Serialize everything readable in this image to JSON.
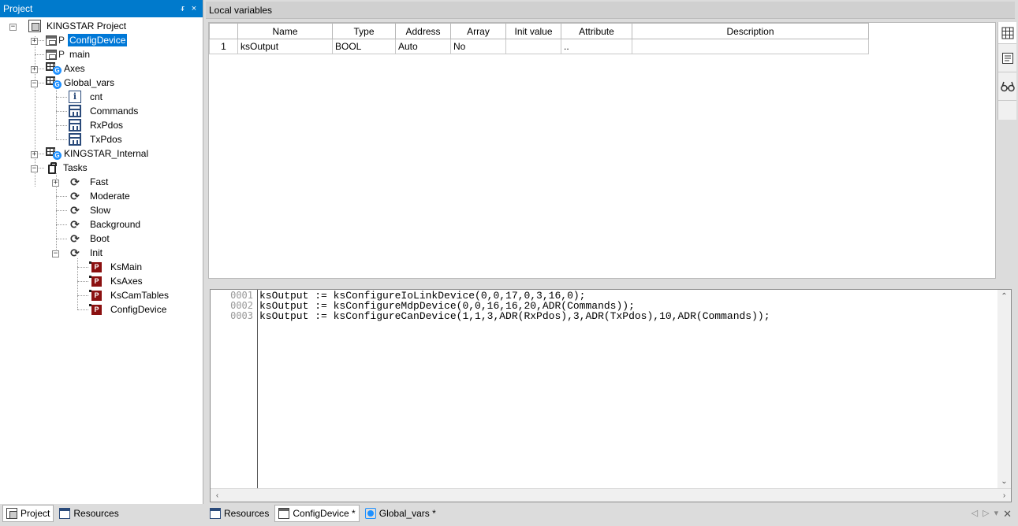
{
  "project_panel": {
    "title": "Project",
    "pin_label": "ᵲ",
    "close_label": "×",
    "tree": [
      {
        "label": "KINGSTAR Project",
        "icon": "project-icon"
      },
      {
        "label": "ConfigDevice",
        "icon": "pou-icon",
        "selected": true
      },
      {
        "label": "main",
        "icon": "pou-icon"
      },
      {
        "label": "Axes",
        "icon": "global-vars-icon"
      },
      {
        "label": "Global_vars",
        "icon": "global-vars-icon"
      },
      {
        "label": "cnt",
        "icon": "info-icon"
      },
      {
        "label": "Commands",
        "icon": "struct-icon"
      },
      {
        "label": "RxPdos",
        "icon": "struct-icon"
      },
      {
        "label": "TxPdos",
        "icon": "struct-icon"
      },
      {
        "label": "KINGSTAR_Internal",
        "icon": "global-vars-icon"
      },
      {
        "label": "Tasks",
        "icon": "tasks-icon"
      },
      {
        "label": "Fast",
        "icon": "cycle-icon"
      },
      {
        "label": "Moderate",
        "icon": "cycle-icon"
      },
      {
        "label": "Slow",
        "icon": "cycle-icon"
      },
      {
        "label": "Background",
        "icon": "cycle-icon"
      },
      {
        "label": "Boot",
        "icon": "cycle-icon"
      },
      {
        "label": "Init",
        "icon": "cycle-icon"
      },
      {
        "label": "KsMain",
        "icon": "program-icon"
      },
      {
        "label": "KsAxes",
        "icon": "program-icon"
      },
      {
        "label": "KsCamTables",
        "icon": "program-icon"
      },
      {
        "label": "ConfigDevice",
        "icon": "program-icon"
      }
    ],
    "p_letter": "P",
    "g_letter": "G",
    "i_letter": "i",
    "prg_letter": "P",
    "bottom_tabs": [
      {
        "label": "Project",
        "active": true
      },
      {
        "label": "Resources",
        "active": false
      }
    ]
  },
  "local_variables": {
    "title": "Local variables",
    "columns": [
      "Name",
      "Type",
      "Address",
      "Array",
      "Init value",
      "Attribute",
      "Description"
    ],
    "rows": [
      {
        "num": "1",
        "name": "ksOutput",
        "type": "BOOL",
        "address": "Auto",
        "array": "No",
        "init_value": "",
        "attribute": "..",
        "description": ""
      }
    ]
  },
  "editor": {
    "lines": [
      {
        "num": "0001",
        "code": "ksOutput := ksConfigureIoLinkDevice(0,0,17,0,3,16,0);"
      },
      {
        "num": "0002",
        "code": "ksOutput := ksConfigureMdpDevice(0,0,16,16,20,ADR(Commands));"
      },
      {
        "num": "0003",
        "code": "ksOutput := ksConfigureCanDevice(1,1,3,ADR(RxPdos),3,ADR(TxPdos),10,ADR(Commands));"
      }
    ]
  },
  "doc_tabs": [
    {
      "label": "Resources",
      "active": false
    },
    {
      "label": "ConfigDevice *",
      "active": true
    },
    {
      "label": "Global_vars *",
      "active": false
    }
  ],
  "colors": {
    "accent": "#007acc",
    "selection": "#0078d7",
    "program_red": "#8b1010"
  }
}
